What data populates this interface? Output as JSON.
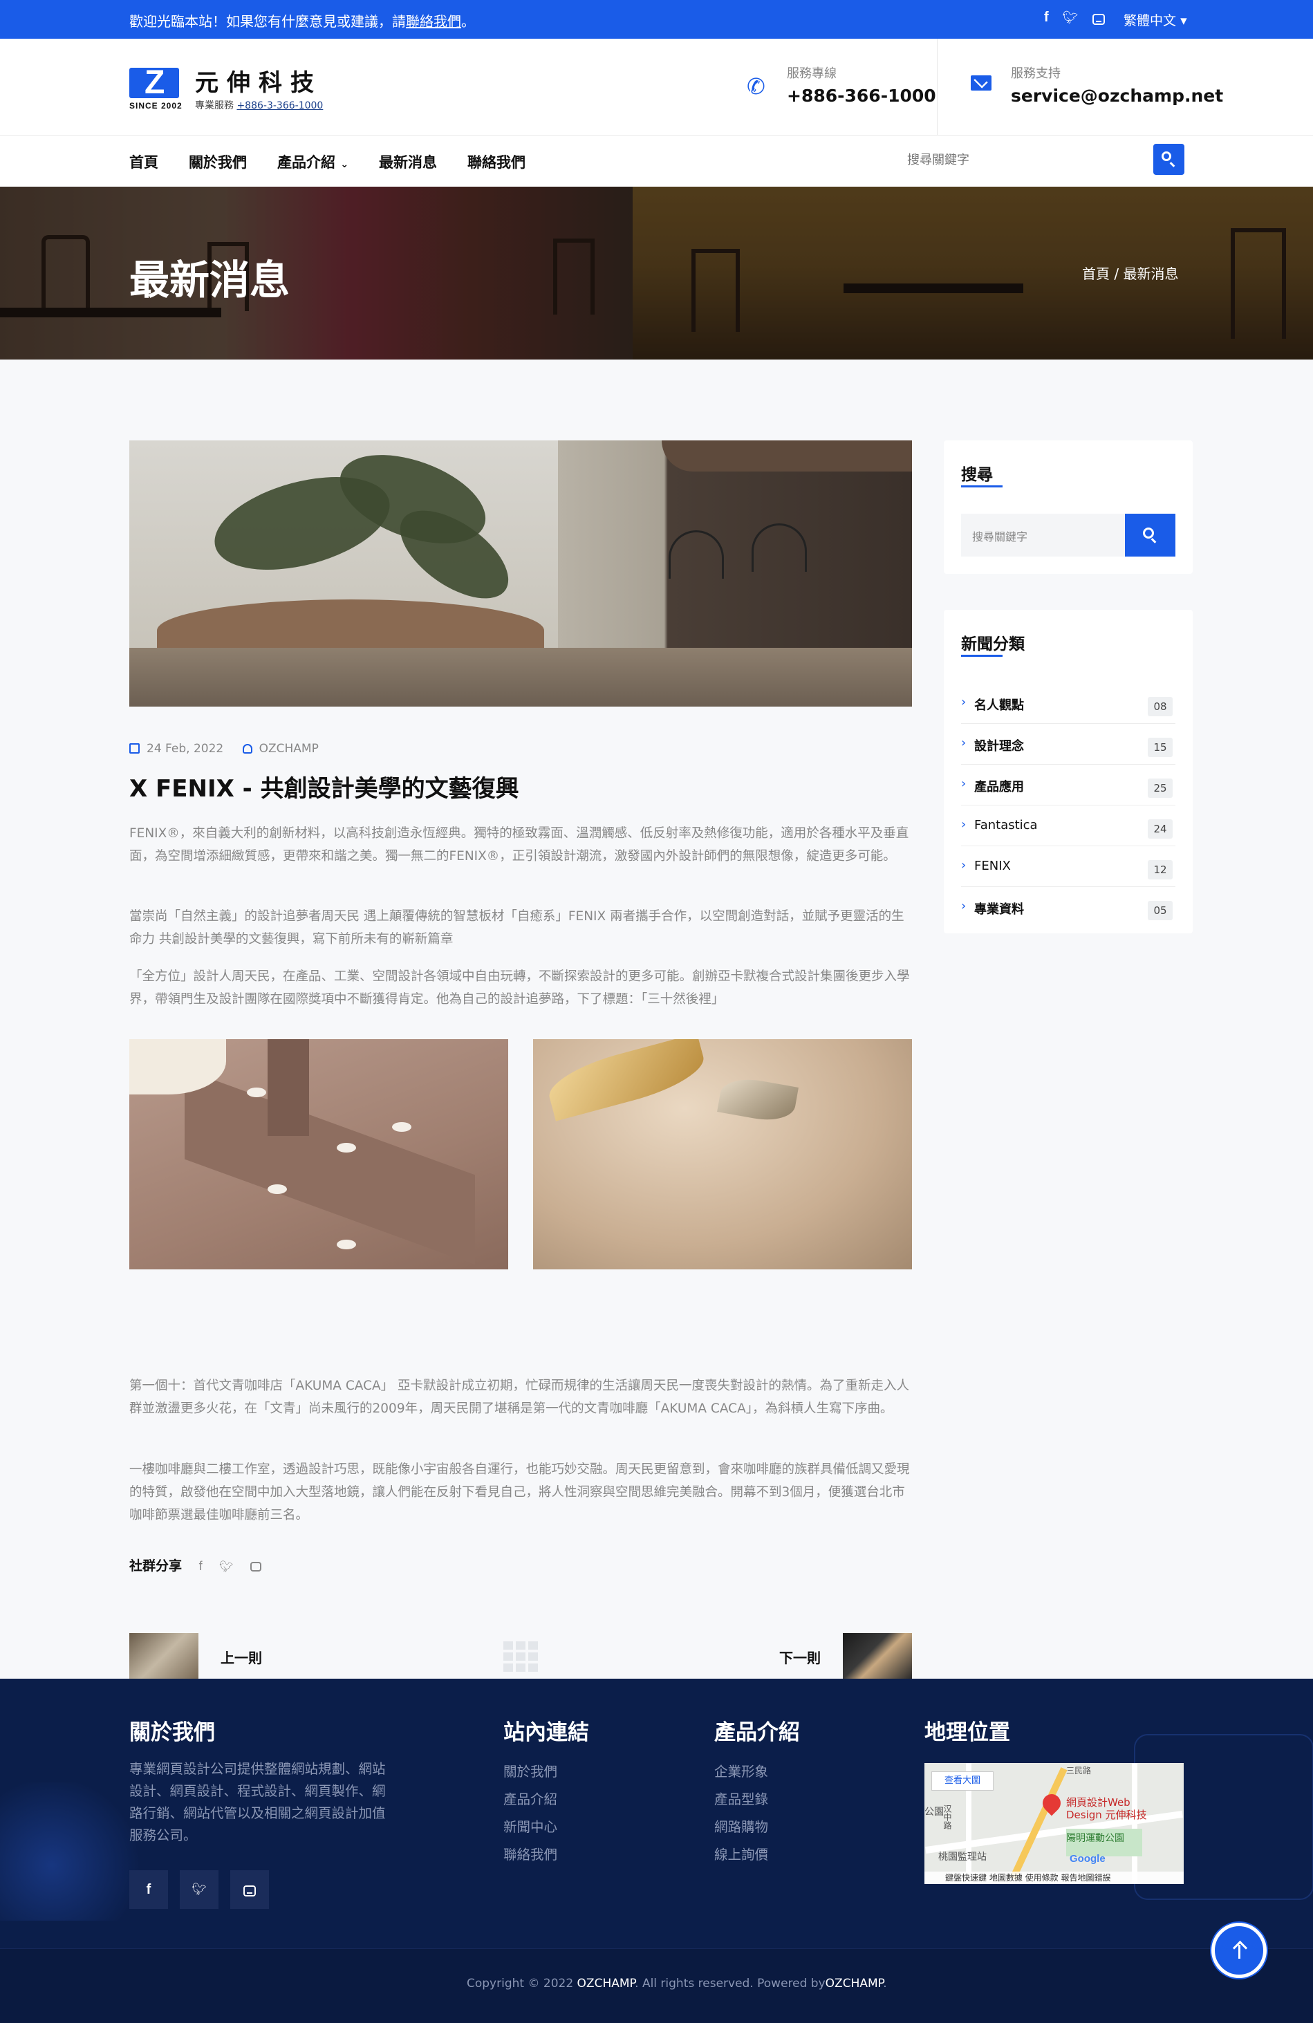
{
  "topbar": {
    "message_prefix": "歡迎光臨本站！如果您有什麼意見或建議，請",
    "message_link": "聯絡我們",
    "message_suffix": "。",
    "language": "繁體中文",
    "social_icons": [
      "facebook-icon",
      "twitter-icon",
      "line-icon"
    ]
  },
  "logo": {
    "name": "元伸科技",
    "since": "SINCE 2002",
    "sub_label": "專業服務",
    "sub_phone": "+886-3-366-1000"
  },
  "contacts": [
    {
      "label": "服務專線",
      "value": "+886-366-1000",
      "icon": "phone-icon"
    },
    {
      "label": "服務支持",
      "value": "service@ozchamp.net",
      "icon": "mail-icon"
    }
  ],
  "nav": {
    "items": [
      "首頁",
      "關於我們",
      "產品介紹",
      "最新消息",
      "聯絡我們"
    ],
    "dropdown_index": 2,
    "search_placeholder": "搜尋關鍵字"
  },
  "banner": {
    "title": "最新消息",
    "breadcrumb_home": "首頁",
    "breadcrumb_sep": "/",
    "breadcrumb_current": "最新消息"
  },
  "article": {
    "date": "24 Feb, 2022",
    "author": "OZCHAMP",
    "title": "X FENIX - 共創設計美學的文藝復興",
    "paragraphs": [
      "FENIX®，來自義大利的創新材料，以高科技創造永恆經典。獨特的極致霧面、溫潤觸感、低反射率及熱修復功能，適用於各種水平及垂直面，為空間增添細緻質感，更帶來和諧之美。獨一無二的FENIX®，正引領設計潮流，激發國內外設計師們的無限想像，綻造更多可能。",
      "當崇尚「自然主義」的設計追夢者周天民 遇上顛覆傳統的智慧板材「自癒系」FENIX 兩者攜手合作，以空間創造對話，並賦予更靈活的生命力 共創設計美學的文藝復興，寫下前所未有的嶄新篇章",
      "「全方位」設計人周天民，在產品、工業、空間設計各領域中自由玩轉，不斷探索設計的更多可能。創辦亞卡默複合式設計集團後更步入學界，帶領門生及設計團隊在國際獎項中不斷獲得肯定。他為自己的設計追夢路，下了標題：「三十然後裡」",
      "第一個十：首代文青咖啡店「AKUMA CACA」 亞卡默設計成立初期，忙碌而規律的生活讓周天民一度喪失對設計的熱情。為了重新走入人群並激盪更多火花，在「文青」尚未風行的2009年，周天民開了堪稱是第一代的文青咖啡廳「AKUMA CACA」，為斜槓人生寫下序曲。",
      "一樓咖啡廳與二樓工作室，透過設計巧思，既能像小宇宙般各自運行，也能巧妙交融。周天民更留意到，會來咖啡廳的族群具備低調又愛現的特質，啟發他在空間中加入大型落地鏡，讓人們能在反射下看見自己，將人性洞察與空間思維完美融合。開幕不到3個月，便獲選台北市咖啡節票選最佳咖啡廳前三名。"
    ],
    "share_label": "社群分享",
    "share_icons": [
      "facebook-icon",
      "twitter-icon",
      "line-icon"
    ],
    "prev_label": "上一則",
    "next_label": "下一則"
  },
  "sidebar": {
    "search_title": "搜尋",
    "search_placeholder": "搜尋關鍵字",
    "categories_title": "新聞分類",
    "categories": [
      {
        "name": "名人觀點",
        "count": "08"
      },
      {
        "name": "設計理念",
        "count": "15"
      },
      {
        "name": "產品應用",
        "count": "25"
      },
      {
        "name": "Fantastica",
        "count": "24"
      },
      {
        "name": "FENIX",
        "count": "12"
      },
      {
        "name": "專業資料",
        "count": "05"
      }
    ]
  },
  "footer": {
    "about_title": "關於我們",
    "about_text": "專業網頁設計公司提供整體網站規劃、網站設計、網頁設計、程式設計、網頁製作、網路行銷、網站代管以及相關之網頁設計加值服務公司。",
    "links_title": "站內連結",
    "links": [
      "關於我們",
      "產品介紹",
      "新聞中心",
      "聯絡我們"
    ],
    "products_title": "產品介紹",
    "products": [
      "企業形象",
      "產品型錄",
      "網路購物",
      "線上詢價"
    ],
    "location_title": "地理位置",
    "map": {
      "view_larger": "查看大圖",
      "place_line1": "網頁設計Web",
      "place_line2": "Design 元伸科技",
      "park": "陽明運動公園",
      "station": "桃園監理站",
      "park_left": "公園",
      "google": "Google",
      "footer_text": "鍵盤快速鍵  地圖數據  使用條款  報告地圖錯誤",
      "road1": "汉中路",
      "road2": "三民路"
    },
    "copyright_prefix": "Copyright © 2022 ",
    "copyright_brand": "OZCHAMP",
    "copyright_middle": ". All rights reserved. Powered by",
    "copyright_powered": "OZCHAMP",
    "copyright_suffix": "."
  }
}
